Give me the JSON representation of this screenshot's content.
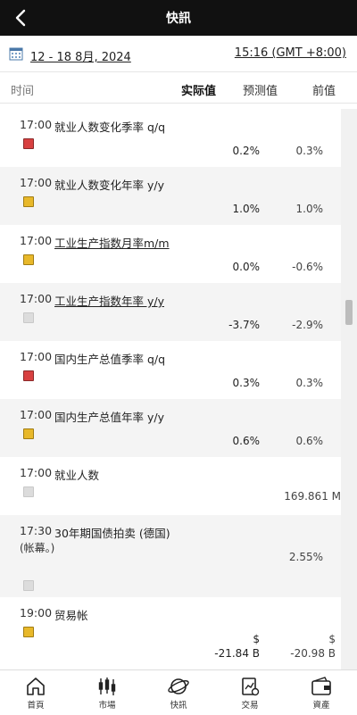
{
  "header": {
    "title": "快訊",
    "back_icon": "chevron-left-icon"
  },
  "datebar": {
    "date_range": "12 - 18 8月, 2024",
    "timezone": "15:16 (GMT +8:00)",
    "calendar_icon": "calendar-icon"
  },
  "columns": {
    "time": "时间",
    "actual": "实际值",
    "forecast": "预测值",
    "previous": "前值"
  },
  "events": [
    {
      "time": "17:00",
      "note": "",
      "name": "就业人数变化季率 q/q",
      "importance": "high",
      "actual": "",
      "forecast": "0.2%",
      "previous": "0.3%"
    },
    {
      "time": "17:00",
      "note": "",
      "name": "就业人数变化年率 y/y",
      "importance": "medium",
      "actual": "",
      "forecast": "1.0%",
      "previous": "1.0%"
    },
    {
      "time": "17:00",
      "note": "",
      "name": "工业生产指数月率m/m",
      "importance": "medium",
      "actual": "",
      "forecast": "0.0%",
      "previous": "-0.6%"
    },
    {
      "time": "17:00",
      "note": "",
      "name": "工业生产指数年率 y/y",
      "importance": "low",
      "actual": "",
      "forecast": "-3.7%",
      "previous": "-2.9%"
    },
    {
      "time": "17:00",
      "note": "",
      "name": "国内生产总值季率 q/q",
      "importance": "high",
      "actual": "",
      "forecast": "0.3%",
      "previous": "0.3%"
    },
    {
      "time": "17:00",
      "note": "",
      "name": "国内生产总值年率 y/y",
      "importance": "medium",
      "actual": "",
      "forecast": "0.6%",
      "previous": "0.6%"
    },
    {
      "time": "17:00",
      "note": "",
      "name": "就业人数",
      "importance": "low",
      "actual": "",
      "forecast": "",
      "previous": "169.861 M"
    },
    {
      "time": "17:30",
      "note": "(帐幕。)",
      "name": "30年期国债拍卖 (德国)",
      "importance": "low",
      "actual": "",
      "forecast": "",
      "previous": "2.55%"
    },
    {
      "time": "19:00",
      "note": "",
      "name": "贸易帐",
      "importance": "medium",
      "actual": "",
      "forecast": "$ -21.84 B",
      "previous": "$ -20.98 B"
    }
  ],
  "colors": {
    "high": "#d84040",
    "medium": "#e8b82a",
    "low": "#dcdcdc"
  },
  "nav": [
    {
      "label": "首頁",
      "icon": "home-icon"
    },
    {
      "label": "市場",
      "icon": "candlestick-icon"
    },
    {
      "label": "快訊",
      "icon": "planet-icon"
    },
    {
      "label": "交易",
      "icon": "trade-icon"
    },
    {
      "label": "資產",
      "icon": "wallet-icon"
    }
  ]
}
